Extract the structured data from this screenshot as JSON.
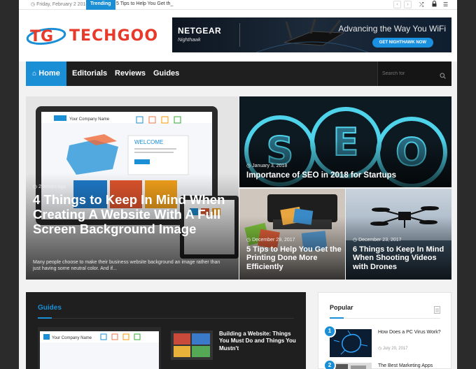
{
  "topbar": {
    "date": "Friday, February 2 2018",
    "trending_label": "Trending",
    "trending_text": "5 Tips to Help You Get th_",
    "prev_label": "‹",
    "next_label": "›"
  },
  "brand": {
    "logo_text": "TECHGOO",
    "logo_mark": "TG",
    "accent": "#1a8fd6"
  },
  "ad": {
    "brand": "NETGEAR",
    "sub": "Nighthawk",
    "tagline": "Advancing the Way You WiFi",
    "cta": "GET NIGHTHAWK NOW"
  },
  "nav": {
    "home": "Home",
    "items": [
      "Editorials",
      "Reviews",
      "Guides"
    ],
    "search_placeholder": "Search for"
  },
  "hero": {
    "main": {
      "date": "2 weeks ago",
      "title": "4 Things to Keep In Mind When Creating A Website With A Full Screen Background Image",
      "excerpt": "Many people choose to make their business website background an image rather than just having some neutral color. And if...",
      "mock_brand": "Your Company Name",
      "mock_welcome": "WELCOME"
    },
    "seo": {
      "date": "January 3, 2018",
      "title": "Importance of SEO in 2018 for Startups",
      "letters": [
        "S",
        "E",
        "O"
      ]
    },
    "printing": {
      "date": "December 29, 2017",
      "title": "5 Tips to Help You Get the Printing Done More Efficiently"
    },
    "drones": {
      "date": "December 23, 2017",
      "title": "6 Things to Keep In Mind When Shooting Videos with Drones"
    }
  },
  "guides": {
    "heading": "Guides",
    "post_title": "Building a Website: Things You Must Do and Things You Mustn't",
    "mock_brand": "Your Company Name"
  },
  "popular": {
    "heading": "Popular",
    "items": [
      {
        "num": "1",
        "title": "How Does a PC Virus Work?",
        "date": "July 20, 2017"
      },
      {
        "num": "2",
        "title": "The Best Marketing Apps"
      }
    ]
  }
}
